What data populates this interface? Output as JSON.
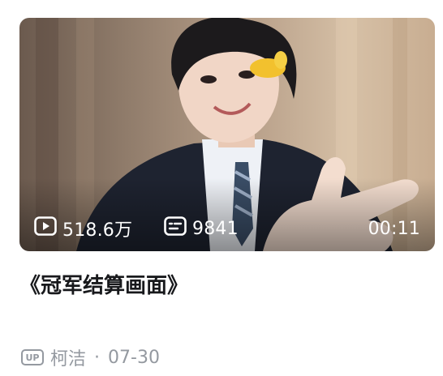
{
  "video": {
    "views": "518.6万",
    "danmaku": "9841",
    "duration": "00:11",
    "title": "《冠军结算画面》",
    "uploader": "柯洁",
    "up_badge": "UP",
    "separator": "·",
    "date": "07-30"
  },
  "icons": {
    "views": "play-count-icon",
    "danmaku": "danmaku-icon",
    "uploader": "up-badge-icon"
  },
  "colors": {
    "title": "#18191c",
    "meta": "#9499a0",
    "overlay_text": "#ffffff"
  }
}
